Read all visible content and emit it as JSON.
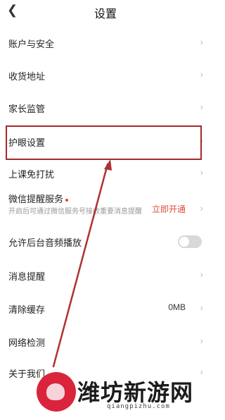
{
  "header": {
    "back_icon": "chevron-left-icon",
    "title": "设置"
  },
  "items": [
    {
      "label": "账户与安全"
    },
    {
      "label": "收货地址"
    },
    {
      "label": "家长监管"
    },
    {
      "label": "护眼设置"
    },
    {
      "label": "上课免打扰"
    },
    {
      "label": "微信提醒服务",
      "subtitle": "开启后可通过微信服务号接收重要消息提醒",
      "action": "立即开通"
    },
    {
      "label": "允许后台音频播放",
      "toggle_on": false
    },
    {
      "label": "消息提醒"
    },
    {
      "label": "清除缓存",
      "value": "0MB"
    },
    {
      "label": "网络检测"
    },
    {
      "label": "关于我们"
    }
  ],
  "watermark": {
    "name": "潍坊新游网",
    "url": "qiangpizhu.com"
  },
  "colors": {
    "highlight": "#a42a2a",
    "accent_red": "#e24a3b",
    "arrow": "#b03030"
  }
}
